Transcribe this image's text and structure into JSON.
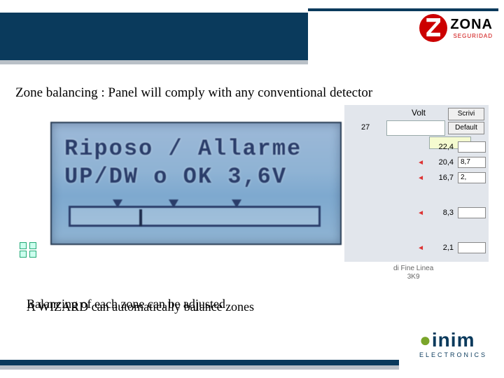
{
  "brand": {
    "zona_name": "ZONA",
    "zona_sub": "SEGURIDAD",
    "inim_name": "inim",
    "inim_sub": "ELECTRONICS"
  },
  "heading": "Zone balancing : Panel will comply with any conventional detector",
  "lcd": {
    "line1": "Riposo / Allarme",
    "line2": "UP/DW o OK 3,6V"
  },
  "panel": {
    "title": "Volt",
    "zone": "27",
    "btn_write": "Scrivi",
    "btn_default": "Default",
    "rows": [
      {
        "val": "22,4",
        "box": ""
      },
      {
        "val": "20,4",
        "box": "8,7"
      },
      {
        "val": "16,7",
        "box": "2,"
      },
      {
        "val": "8,3",
        "box": ""
      },
      {
        "val": "2,1",
        "box": ""
      }
    ],
    "caption_line1": "di Fine Linea",
    "caption_line2": "3K9"
  },
  "bottom": {
    "line1": "Balancing of each zone can be adjusted",
    "line2": "A WIZARD can automatically balance zones"
  }
}
